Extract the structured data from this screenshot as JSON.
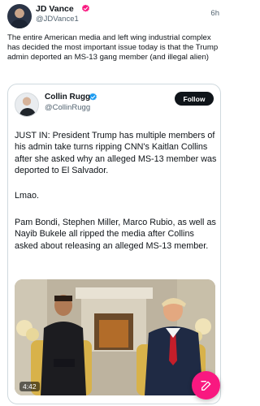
{
  "post": {
    "author_name": "JD Vance",
    "author_handle": "@JDVance1",
    "time": "6h",
    "text": "The entire American media and left wing industrial complex has decided the most important issue today is that the Trump admin deported an MS-13 gang member (and illegal alien)"
  },
  "quote": {
    "author_name": "Collin Rugg",
    "author_handle": "@CollinRugg",
    "follow_label": "Follow",
    "paragraphs": [
      "JUST IN: President Trump has multiple members of his admin take turns ripping CNN's Kaitlan Collins after she asked why an alleged MS-13 member was deported to El Salvador.",
      "Lmao.",
      "Pam Bondi, Stephen Miller, Marco Rubio, as well as Nayib Bukele all ripped the media after Collins asked about releasing an alleged MS-13 member."
    ],
    "video": {
      "duration": "4:42"
    }
  },
  "icons": {
    "verified": "verified-badge-icon",
    "compose": "compose-icon"
  },
  "colors": {
    "verified_badge": "#f91880",
    "quote_verified_badge": "#1d9bf0",
    "fab": "#f91880"
  }
}
